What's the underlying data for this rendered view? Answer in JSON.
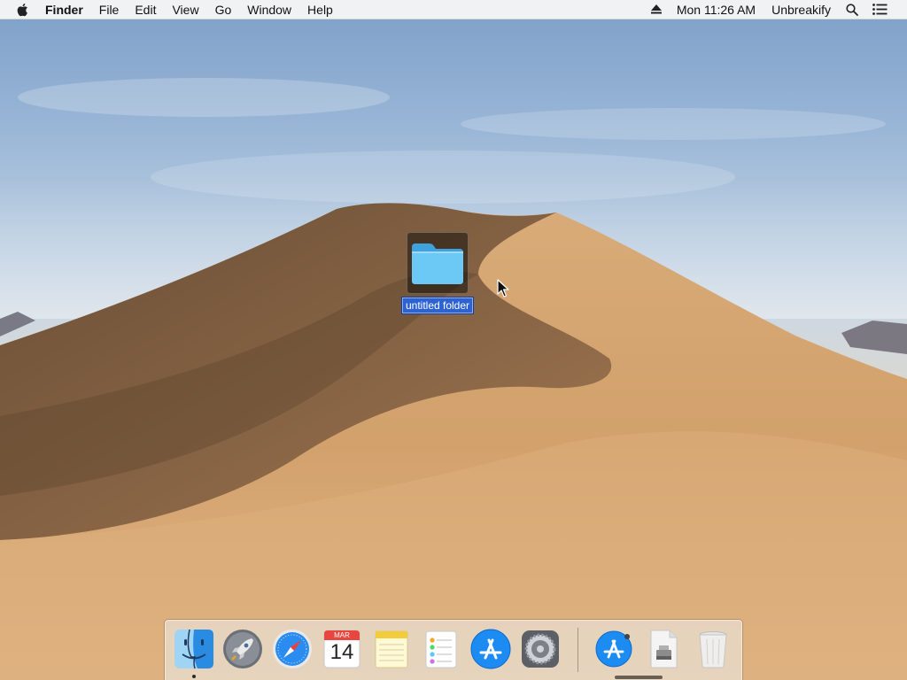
{
  "menubar": {
    "apple_icon": "apple-logo-icon",
    "app_name": "Finder",
    "menus": [
      "File",
      "Edit",
      "View",
      "Go",
      "Window",
      "Help"
    ],
    "clock": "Mon 11:26 AM",
    "user": "Unbreakify",
    "status_icons": [
      "eject-icon",
      "spotlight-search-icon",
      "notification-center-icon"
    ]
  },
  "desktop": {
    "wallpaper": "macOS Mojave desert dune",
    "folder": {
      "name": "untitled folder",
      "selected": true,
      "renaming": true
    }
  },
  "dock": {
    "apps": [
      {
        "name": "Finder",
        "icon": "finder-icon",
        "running": true
      },
      {
        "name": "Launchpad",
        "icon": "launchpad-rocket-icon",
        "running": false
      },
      {
        "name": "Safari",
        "icon": "safari-compass-icon",
        "running": false
      },
      {
        "name": "Calendar",
        "icon": "calendar-icon",
        "running": false
      },
      {
        "name": "Notes",
        "icon": "notes-icon",
        "running": false
      },
      {
        "name": "Reminders",
        "icon": "reminders-icon",
        "running": false
      },
      {
        "name": "App Store",
        "icon": "app-store-icon",
        "running": false
      },
      {
        "name": "System Preferences",
        "icon": "system-preferences-gear-icon",
        "running": false
      }
    ],
    "calendar": {
      "month": "MAR",
      "day": "14"
    },
    "others": [
      {
        "name": "Downloads",
        "icon": "app-store-download-icon"
      },
      {
        "name": "Disk image",
        "icon": "disk-image-icon"
      },
      {
        "name": "Trash",
        "icon": "trash-icon"
      }
    ]
  },
  "colors": {
    "selection": "#2c62d1",
    "folder_blue": "#5cc1f4",
    "menubar_bg": "#f6f6f6"
  }
}
